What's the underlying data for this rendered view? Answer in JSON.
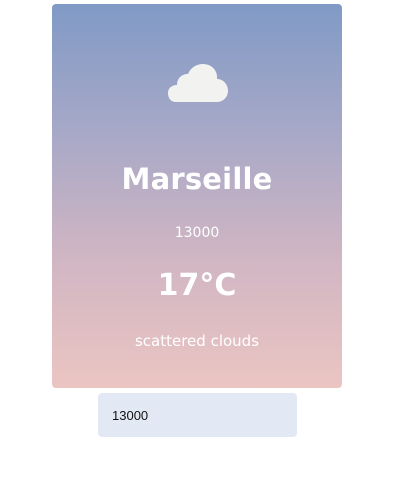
{
  "card": {
    "icon": "cloud-icon",
    "city": "Marseille",
    "zip": "13000",
    "temperature": "17°C",
    "description": "scattered clouds"
  },
  "zip_input": {
    "value": "13000"
  },
  "colors": {
    "gradient_top": "#809ac6",
    "gradient_bottom": "#ebc5c2",
    "text": "#ffffff",
    "input_bg": "#e3e9f4",
    "cloud": "#f2f2f0"
  }
}
